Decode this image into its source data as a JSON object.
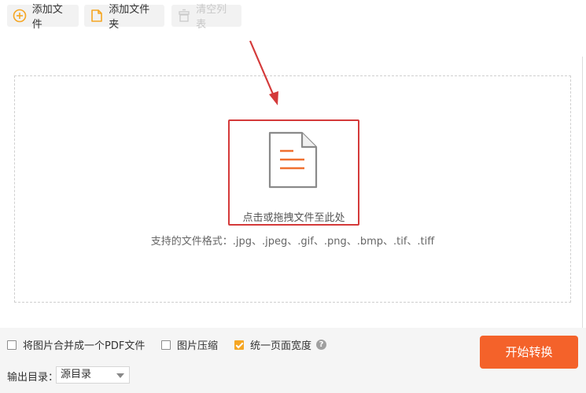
{
  "toolbar": {
    "add_file": "添加文件",
    "add_folder": "添加文件夹",
    "clear_list": "清空列表"
  },
  "dropzone": {
    "drop_text": "点击或拖拽文件至此处",
    "formats": "支持的文件格式：.jpg、.jpeg、.gif、.png、.bmp、.tif、.tiff"
  },
  "options": {
    "merge_pdf": {
      "label": "将图片合并成一个PDF文件",
      "checked": false
    },
    "compress": {
      "label": "图片压缩",
      "checked": false
    },
    "uniform_width": {
      "label": "统一页面宽度",
      "checked": true
    },
    "help": "?"
  },
  "output": {
    "label": "输出目录：",
    "selected": "源目录"
  },
  "start_button": "开始转换",
  "colors": {
    "accent": "#f4622a",
    "checkbox_checked": "#f5a623",
    "highlight": "#d43a3a",
    "add_icon": "#f5a623"
  },
  "icons": {
    "add_file": "plus-circle-icon",
    "add_folder": "folder-icon",
    "clear_list": "trash-icon",
    "document": "document-icon",
    "dropdown": "chevron-down-icon",
    "help": "help-icon"
  }
}
